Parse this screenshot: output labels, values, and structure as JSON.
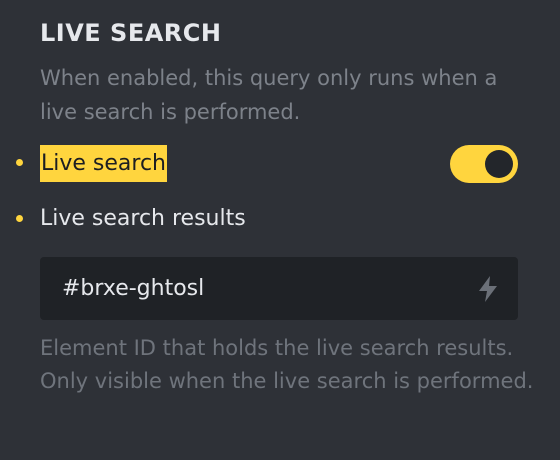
{
  "section": {
    "title": "LIVE SEARCH",
    "description": "When enabled, this query only runs when a live search is performed."
  },
  "live_search": {
    "label": "Live search",
    "enabled": true,
    "marker_color": "#ffd53e"
  },
  "live_search_results": {
    "label": "Live search results",
    "value": "#brxe-ghtosl",
    "icon": "bolt-icon",
    "help": "Element ID that holds the live search results. Only visible when the live search is performed."
  },
  "colors": {
    "accent": "#ffd53e",
    "background": "#2e3137",
    "input_background": "#1f2226"
  }
}
